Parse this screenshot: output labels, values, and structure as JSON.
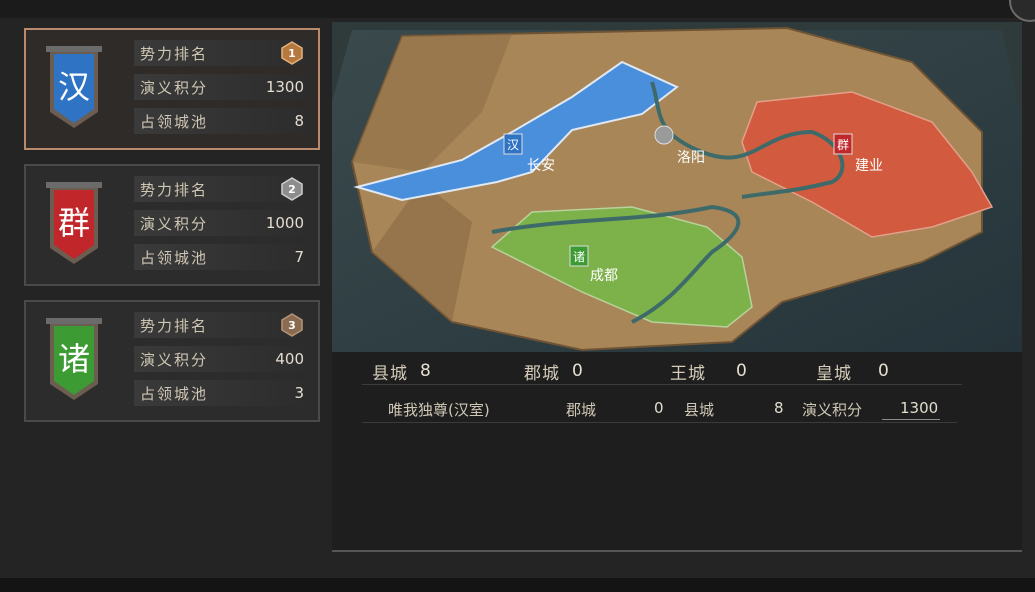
{
  "factions": [
    {
      "char": "汉",
      "color": "#2f73c4",
      "rank_label": "势力排名",
      "rank": "1",
      "medal_color": "#b5783e",
      "score_label": "演义积分",
      "score": "1300",
      "cities_label": "占领城池",
      "cities": "8",
      "selected": true
    },
    {
      "char": "群",
      "color": "#c0262a",
      "rank_label": "势力排名",
      "rank": "2",
      "medal_color": "#8d8d8d",
      "score_label": "演义积分",
      "score": "1000",
      "cities_label": "占领城池",
      "cities": "7",
      "selected": false
    },
    {
      "char": "诸",
      "color": "#3c9c33",
      "rank_label": "势力排名",
      "rank": "3",
      "medal_color": "#8a6a50",
      "score_label": "演义积分",
      "score": "400",
      "cities_label": "占领城池",
      "cities": "3",
      "selected": false
    }
  ],
  "map": {
    "cities": [
      {
        "name": "长安",
        "flag": "汉",
        "flag_color": "#2f73c4"
      },
      {
        "name": "洛阳",
        "flag": "",
        "flag_color": "#9a9a9a"
      },
      {
        "name": "建业",
        "flag": "群",
        "flag_color": "#c0262a"
      },
      {
        "name": "成都",
        "flag": "诸",
        "flag_color": "#3c9c33"
      }
    ]
  },
  "stats": {
    "county_label": "县城",
    "county": "8",
    "commandery_label": "郡城",
    "commandery": "0",
    "king_label": "王城",
    "king": "0",
    "imperial_label": "皇城",
    "imperial": "0"
  },
  "detail": {
    "name": "唯我独尊(汉室)",
    "commandery_label": "郡城",
    "commandery": "0",
    "county_label": "县城",
    "county": "8",
    "score_label": "演义积分",
    "score": "1300"
  }
}
